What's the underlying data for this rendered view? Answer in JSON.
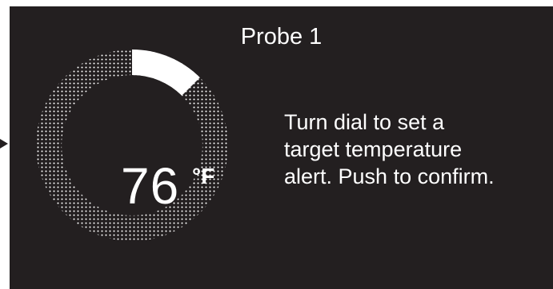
{
  "screen": {
    "title": "Probe 1",
    "temperature": {
      "value": "76",
      "unit": "°F",
      "dial_progress": 0.125
    },
    "instructions": {
      "line1": "Turn dial to set a",
      "line2": "target temperature",
      "line3": "alert. Push to confirm."
    }
  },
  "colors": {
    "screen_background": "#231f20",
    "foreground": "#ffffff"
  },
  "icons": {
    "side_indicator": "arrow-right-icon"
  }
}
